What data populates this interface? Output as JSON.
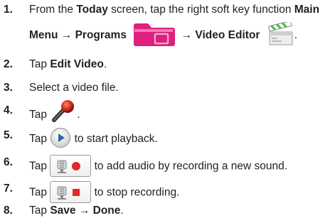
{
  "steps": [
    {
      "num": "1.",
      "line1": {
        "t1": "From the ",
        "today": "Today",
        "t2": " screen, tap the right soft key function ",
        "main": "Main"
      },
      "line2": {
        "menu": "Menu",
        "arrow1": "→",
        "programs": "Programs",
        "arrow2": "→",
        "video_editor": "Video Editor",
        "period": "."
      },
      "icons": [
        "programs-folder-icon",
        "clapperboard-icon"
      ]
    },
    {
      "num": "2.",
      "t1": "Tap ",
      "edit_video": "Edit Video",
      "period": "."
    },
    {
      "num": "3.",
      "text": "Select a video file."
    },
    {
      "num": "4.",
      "t1": "Tap ",
      "period": ".",
      "icon": "microphone-icon"
    },
    {
      "num": "5.",
      "t1": "Tap ",
      "t2": " to start playback.",
      "icon": "play-button-icon"
    },
    {
      "num": "6.",
      "t1": "Tap ",
      "t2": " to add audio by recording a new sound.",
      "icon": "record-audio-button-icon"
    },
    {
      "num": "7.",
      "t1": "Tap ",
      "t2": " to stop recording.",
      "icon": "stop-recording-button-icon"
    },
    {
      "num": "8.",
      "t1": "Tap ",
      "save": "Save",
      "arrow": "→",
      "done": "Done",
      "period": "."
    }
  ],
  "colors": {
    "text": "#231f20",
    "folder_magenta": "#e0207f",
    "record_red": "#e0282a",
    "play_blue": "#2f63b0"
  }
}
